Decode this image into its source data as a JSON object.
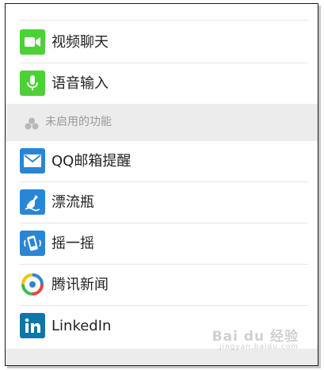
{
  "enabled_items": [
    {
      "label": "视频聊天",
      "icon": "video-camera-icon",
      "color": "#4cd137"
    },
    {
      "label": "语音输入",
      "icon": "microphone-icon",
      "color": "#4cd137"
    }
  ],
  "disabled_section": {
    "title": "未启用的功能",
    "icon": "features-cluster-icon"
  },
  "disabled_items": [
    {
      "label": "QQ邮箱提醒",
      "icon": "mail-envelope-icon",
      "color": "#2a86d4"
    },
    {
      "label": "漂流瓶",
      "icon": "drift-bottle-icon",
      "color": "#2a86d4"
    },
    {
      "label": "摇一摇",
      "icon": "shake-phone-icon",
      "color": "#2a86d4"
    },
    {
      "label": "腾讯新闻",
      "icon": "tencent-news-icon",
      "color": "#f0a020"
    },
    {
      "label": "LinkedIn",
      "icon": "linkedin-icon",
      "color": "#0e76a8"
    }
  ],
  "watermark": {
    "text": "Bai du 经验",
    "sub": "jingyan.baidu.com"
  }
}
